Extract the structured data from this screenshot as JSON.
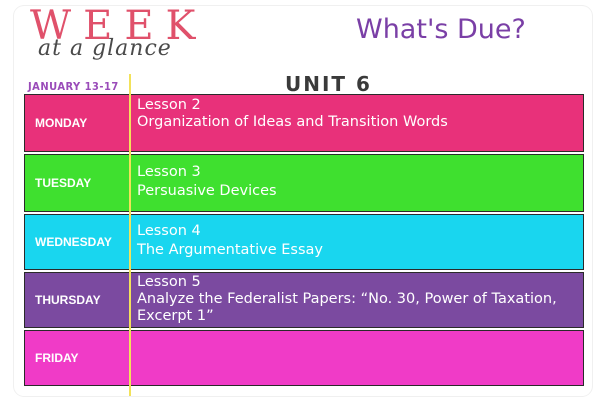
{
  "header": {
    "title_week": "WEEK",
    "title_glance": "at a glance",
    "whats_due": "What's Due?",
    "date_range": "JANUARY 13-17",
    "unit": "UNIT 6"
  },
  "colors": {
    "monday": "#e8317a",
    "tuesday": "#3fe02f",
    "wednesday": "#19d6ef",
    "thursday": "#7b4aa0",
    "friday": "#f03bc7",
    "divider": "#f2e25a"
  },
  "days": [
    {
      "label": "MONDAY",
      "lesson": "Lesson 2",
      "topic": "Organization of Ideas and Transition Words"
    },
    {
      "label": "TUESDAY",
      "lesson": "Lesson 3",
      "topic": "Persuasive Devices"
    },
    {
      "label": "WEDNESDAY",
      "lesson": "Lesson 4",
      "topic": "The Argumentative Essay"
    },
    {
      "label": "THURSDAY",
      "lesson": "Lesson 5",
      "topic": "Analyze the Federalist Papers:  “No. 30, Power of Taxation, Excerpt 1”"
    },
    {
      "label": "FRIDAY",
      "lesson": "",
      "topic": ""
    }
  ]
}
